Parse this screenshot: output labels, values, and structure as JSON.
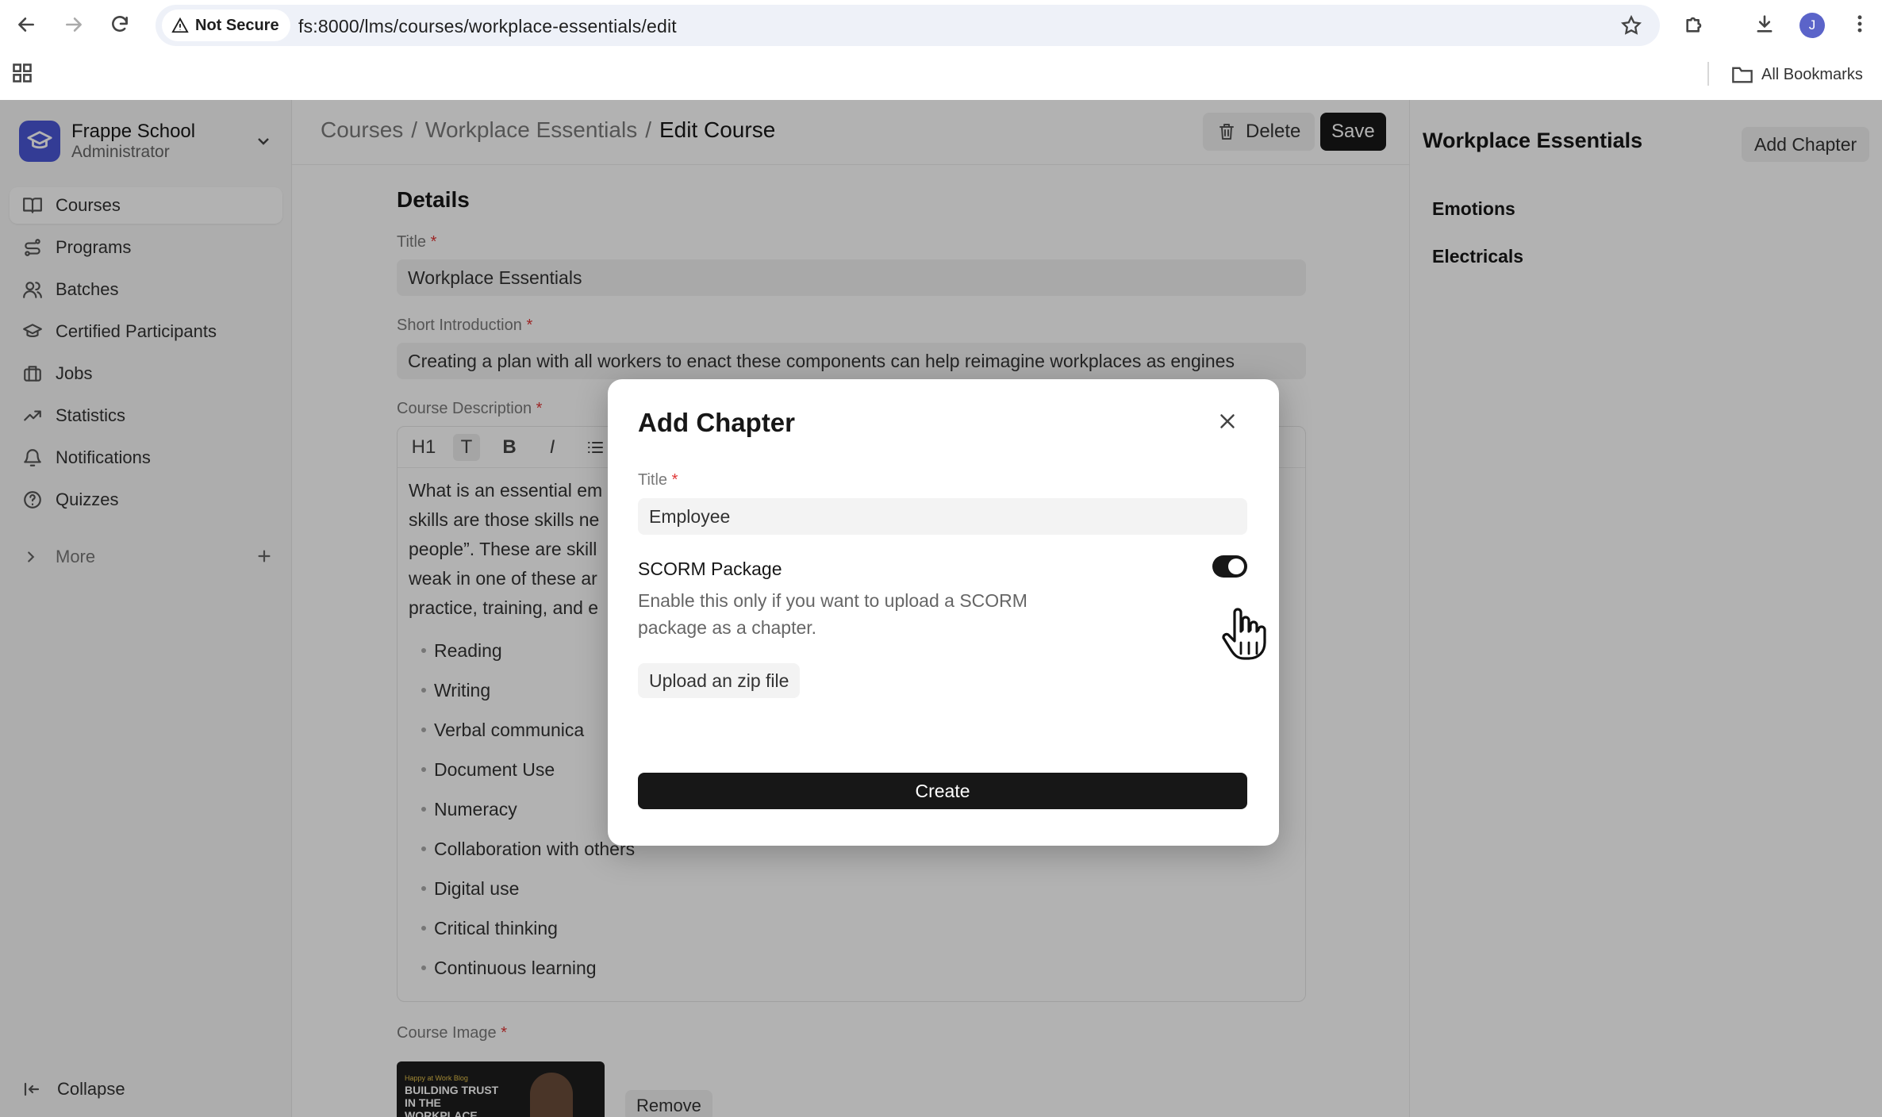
{
  "browser": {
    "security_label": "Not Secure",
    "url": "fs:8000/lms/courses/workplace-essentials/edit",
    "profile_initial": "J",
    "bookmarks_label": "All Bookmarks"
  },
  "sidebar": {
    "brand_name": "Frappe School",
    "brand_role": "Administrator",
    "items": [
      {
        "label": "Courses",
        "icon": "book-icon"
      },
      {
        "label": "Programs",
        "icon": "route-icon"
      },
      {
        "label": "Batches",
        "icon": "users-icon"
      },
      {
        "label": "Certified Participants",
        "icon": "graduation-cap-icon"
      },
      {
        "label": "Jobs",
        "icon": "briefcase-icon"
      },
      {
        "label": "Statistics",
        "icon": "trending-up-icon"
      },
      {
        "label": "Notifications",
        "icon": "bell-icon"
      },
      {
        "label": "Quizzes",
        "icon": "help-circle-icon"
      }
    ],
    "more_label": "More",
    "collapse_label": "Collapse"
  },
  "header": {
    "breadcrumb": [
      "Courses",
      "Workplace Essentials",
      "Edit Course"
    ],
    "separator": "/",
    "delete_label": "Delete",
    "save_label": "Save"
  },
  "form": {
    "section_title": "Details",
    "title_label": "Title",
    "title_value": "Workplace Essentials",
    "intro_label": "Short Introduction",
    "intro_value": "Creating a plan with all workers to enact these components can help reimagine workplaces as engines",
    "description_label": "Course Description",
    "toolbar": [
      "H1",
      "T",
      "B",
      "I"
    ],
    "description_lines": [
      "What is an essential em",
      "skills are those skills ne",
      "people”. These are skill",
      "weak in one of these ar",
      "practice, training, and e"
    ],
    "description_list": [
      "Reading",
      "Writing",
      "Verbal communica",
      "Document Use",
      "Numeracy",
      "Collaboration with others",
      "Digital use",
      "Critical thinking",
      "Continuous learning"
    ],
    "image_label": "Course Image",
    "image_caption_small": "Happy at Work Blog",
    "image_caption": "BUILDING TRUST IN THE WORKPLACE",
    "remove_label": "Remove",
    "required_mark": "*"
  },
  "outline": {
    "title": "Workplace Essentials",
    "add_chapter_label": "Add Chapter",
    "chapters": [
      "Emotions",
      "Electricals"
    ]
  },
  "modal": {
    "title": "Add Chapter",
    "title_field_label": "Title",
    "title_field_value": "Employee",
    "scorm_label": "SCORM Package",
    "scorm_description": "Enable this only if you want to upload a SCORM package as a chapter.",
    "scorm_enabled": true,
    "upload_label": "Upload an zip file",
    "create_label": "Create"
  }
}
